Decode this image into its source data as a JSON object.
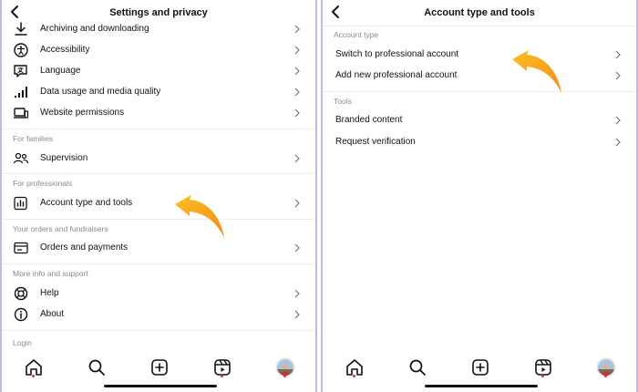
{
  "left": {
    "title": "Settings and privacy",
    "items_top": [
      {
        "label": "Archiving and downloading",
        "icon": "download-icon"
      },
      {
        "label": "Accessibility",
        "icon": "accessibility-icon"
      },
      {
        "label": "Language",
        "icon": "language-icon"
      },
      {
        "label": "Data usage and media quality",
        "icon": "signal-bars-icon"
      },
      {
        "label": "Website permissions",
        "icon": "laptop-icon"
      }
    ],
    "section_families": "For families",
    "supervision": "Supervision",
    "section_professionals": "For professionals",
    "account_type": "Account type and tools",
    "section_orders": "Your orders and fundraisers",
    "orders": "Orders and payments",
    "section_more": "More info and support",
    "help": "Help",
    "about": "About",
    "section_login": "Login"
  },
  "right": {
    "title": "Account type and tools",
    "section_account_type": "Account type",
    "switch_pro": "Switch to professional account",
    "add_pro": "Add new professional account",
    "section_tools": "Tools",
    "branded": "Branded content",
    "request_verification": "Request verification"
  },
  "tabs": [
    "home-icon",
    "search-icon",
    "create-icon",
    "reels-icon",
    "profile-avatar"
  ],
  "colors": {
    "arrow": "#f59a1b",
    "frame_border": "#c9b6e4",
    "section_text": "#8a8a8a",
    "notification_dot": "#e0245e"
  }
}
